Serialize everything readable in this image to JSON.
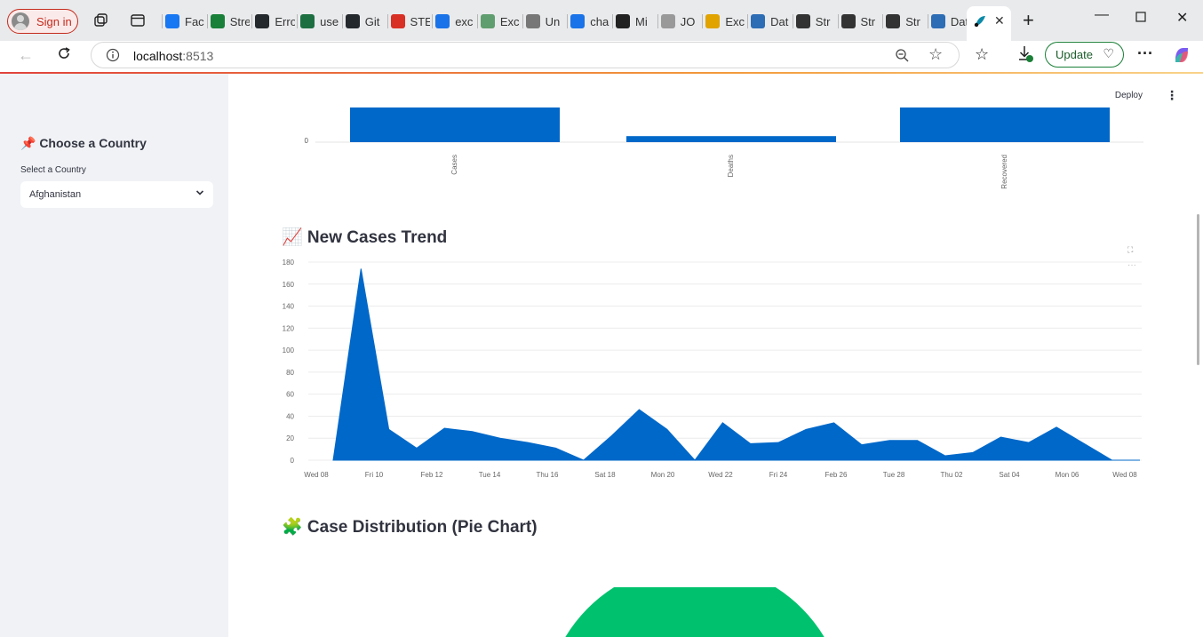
{
  "browser": {
    "signin_label": "Sign in",
    "tabs": [
      {
        "label": "Fac",
        "color": "#1877f2"
      },
      {
        "label": "Stre",
        "color": "#188038"
      },
      {
        "label": "Erro",
        "color": "#24292e"
      },
      {
        "label": "use",
        "color": "#1d6f42"
      },
      {
        "label": "Git",
        "color": "#24292e"
      },
      {
        "label": "STE",
        "color": "#d93025"
      },
      {
        "label": "exc",
        "color": "#1a73e8"
      },
      {
        "label": "Exc",
        "color": "#5f9e6e"
      },
      {
        "label": "Un",
        "color": "#777777"
      },
      {
        "label": "cha",
        "color": "#1a73e8"
      },
      {
        "label": "Mi",
        "color": "#222222"
      },
      {
        "label": "JO",
        "color": "#999999"
      },
      {
        "label": "Exc",
        "color": "#e0a300"
      },
      {
        "label": "Dat",
        "color": "#2d6db5"
      },
      {
        "label": "Str",
        "color": "#333333"
      },
      {
        "label": "Str",
        "color": "#333333"
      },
      {
        "label": "Str",
        "color": "#333333"
      },
      {
        "label": "Dat",
        "color": "#2d6db5"
      }
    ],
    "url_host": "localhost",
    "url_port": ":8513",
    "update_label": "Update"
  },
  "sidebar": {
    "heading": "📌 Choose a Country",
    "select_label": "Select a Country",
    "selected_country": "Afghanistan"
  },
  "header": {
    "deploy_label": "Deploy"
  },
  "bar_section": {
    "zero_tick": "0",
    "categories": [
      "Cases",
      "Deaths",
      "Recovered"
    ]
  },
  "trend_section": {
    "title": "📈 New Cases Trend"
  },
  "pie_section": {
    "title": "🧩 Case Distribution (Pie Chart)"
  },
  "colors": {
    "bar": "#0068c9",
    "pie_slice": "#00c26e"
  },
  "chart_data": [
    {
      "type": "bar",
      "categories": [
        "Cases",
        "Deaths",
        "Recovered"
      ],
      "values_visible_fraction": [
        1.0,
        0.17,
        1.0
      ],
      "note_ticks": [
        "0"
      ]
    },
    {
      "type": "area",
      "yticks": [
        0,
        20,
        40,
        60,
        80,
        100,
        120,
        140,
        160,
        180
      ],
      "ylim": [
        0,
        180
      ],
      "xticks": [
        "Wed 08",
        "Fri 10",
        "Feb 12",
        "Tue 14",
        "Thu 16",
        "Sat 18",
        "Mon 20",
        "Wed 22",
        "Fri 24",
        "Feb 26",
        "Tue 28",
        "Thu 02",
        "Sat 04",
        "Mon 06",
        "Wed 08"
      ],
      "x": [
        0,
        1,
        2,
        3,
        4,
        5,
        6,
        7,
        8,
        9,
        10,
        11,
        12,
        13,
        14,
        15,
        16,
        17,
        18,
        19,
        20,
        21,
        22,
        23,
        24,
        25,
        26,
        27,
        28,
        29
      ],
      "values": [
        0,
        174,
        28,
        11,
        29,
        26,
        20,
        16,
        11,
        0,
        22,
        46,
        28,
        0,
        34,
        15,
        16,
        28,
        34,
        14,
        18,
        18,
        4,
        7,
        21,
        16,
        30,
        15,
        0,
        0
      ]
    }
  ]
}
